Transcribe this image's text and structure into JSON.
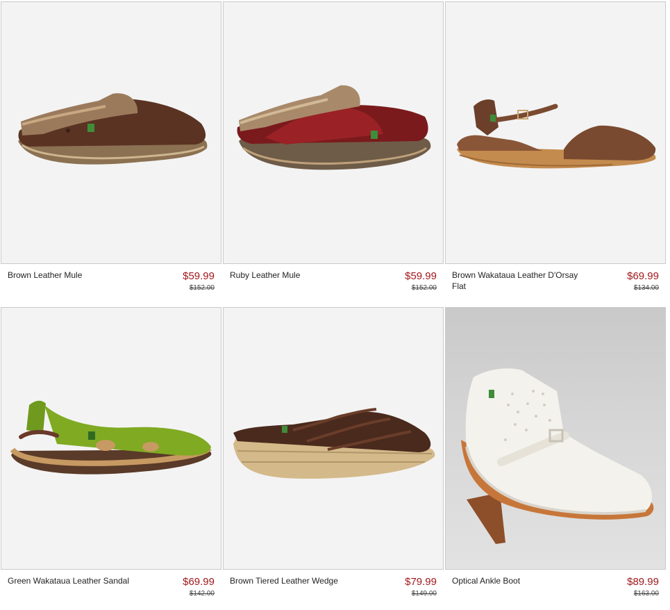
{
  "products": [
    {
      "name": "Brown Leather Mule",
      "price": "$59.99",
      "original_price": "$152.00"
    },
    {
      "name": "Ruby Leather Mule",
      "price": "$59.99",
      "original_price": "$152.00"
    },
    {
      "name": "Brown Wakataua Leather D'Orsay Flat",
      "price": "$69.99",
      "original_price": "$134.00"
    },
    {
      "name": "Green Wakataua Leather Sandal",
      "price": "$69.99",
      "original_price": "$142.00"
    },
    {
      "name": "Brown Tiered Leather Wedge",
      "price": "$79.99",
      "original_price": "$149.00"
    },
    {
      "name": "Optical Ankle Boot",
      "price": "$89.99",
      "original_price": "$163.00"
    }
  ],
  "colors": {
    "price": "#a1181c",
    "tile_background": "#f3f3f3",
    "tile_border": "#c9c9c9"
  }
}
